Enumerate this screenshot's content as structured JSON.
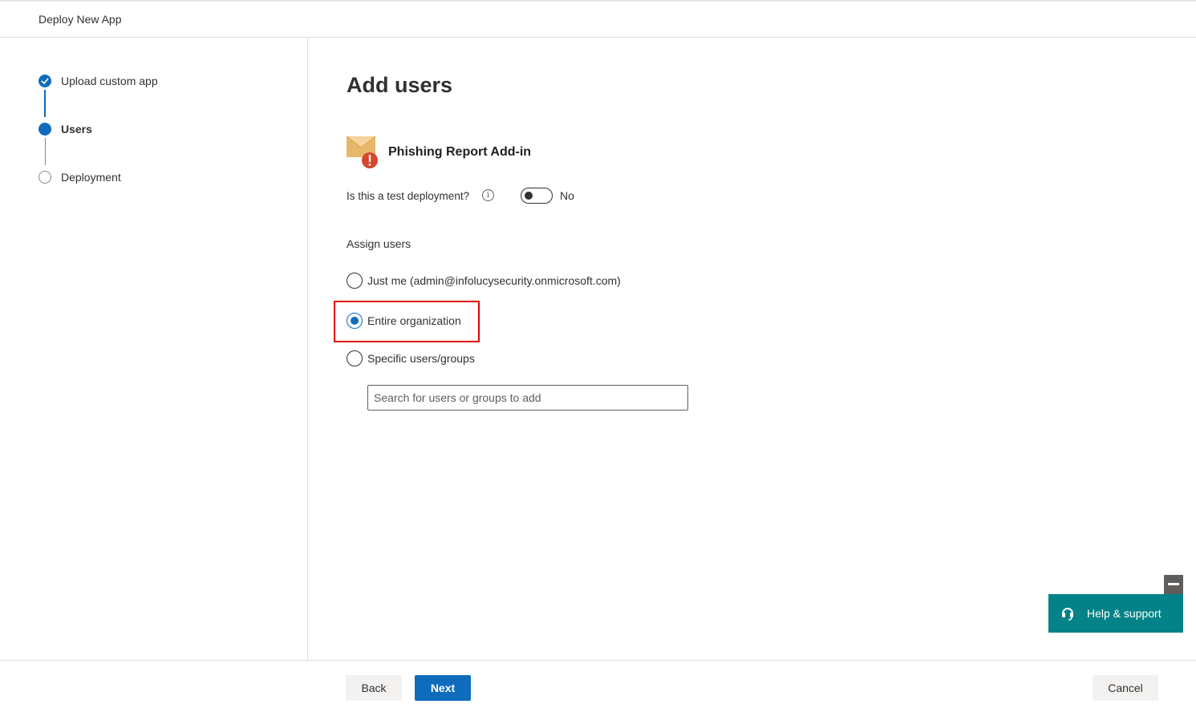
{
  "header": {
    "title": "Deploy New App"
  },
  "steps": [
    {
      "label": "Upload custom app",
      "state": "done"
    },
    {
      "label": "Users",
      "state": "current"
    },
    {
      "label": "Deployment",
      "state": "todo"
    }
  ],
  "main": {
    "heading": "Add users",
    "app": {
      "name": "Phishing Report Add-in",
      "icon": "mail-warning-icon"
    },
    "test_deployment": {
      "label": "Is this a test deployment?",
      "info_glyph": "i",
      "toggle_on": false,
      "state_text": "No"
    },
    "assign": {
      "label": "Assign users",
      "options": [
        {
          "label": "Just me (admin@infolucysecurity.onmicrosoft.com)",
          "checked": false
        },
        {
          "label": "Entire organization",
          "checked": true
        },
        {
          "label": "Specific users/groups",
          "checked": false
        }
      ],
      "search_placeholder": "Search for users or groups to add"
    }
  },
  "help": {
    "label": "Help & support"
  },
  "footer": {
    "back": "Back",
    "next": "Next",
    "cancel": "Cancel"
  },
  "colors": {
    "accent": "#0f6cbd",
    "help": "#038387",
    "highlight": "#e00000"
  }
}
